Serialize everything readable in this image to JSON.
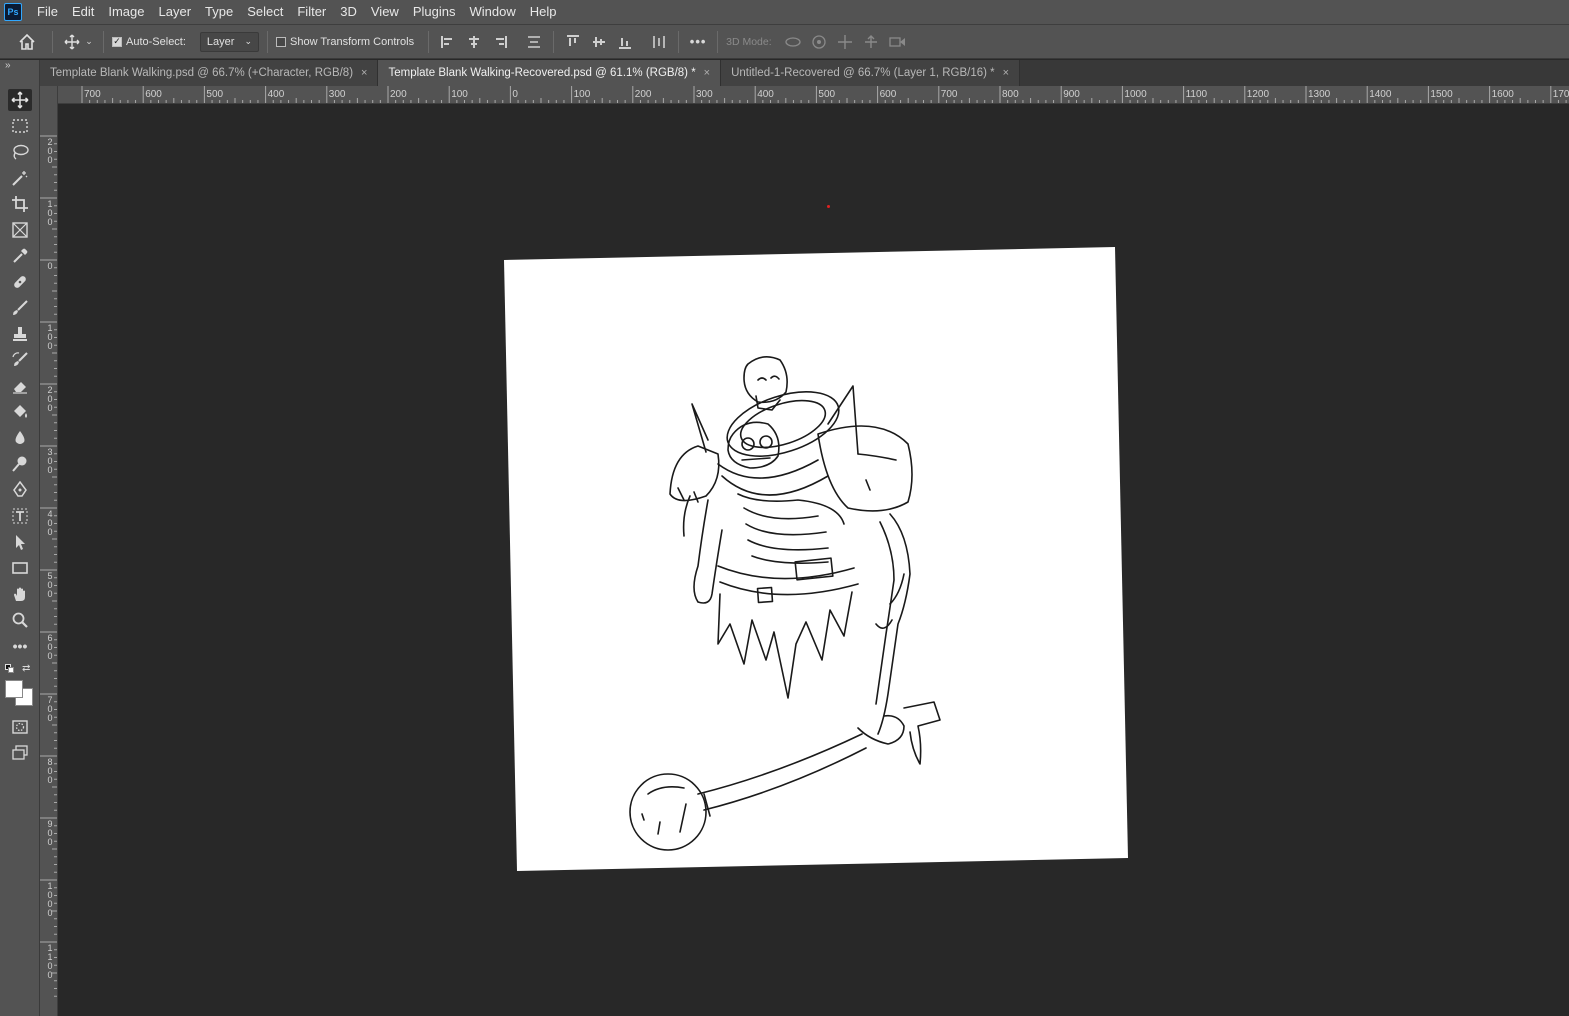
{
  "menubar": {
    "logo": "Ps",
    "items": [
      "File",
      "Edit",
      "Image",
      "Layer",
      "Type",
      "Select",
      "Filter",
      "3D",
      "View",
      "Plugins",
      "Window",
      "Help"
    ]
  },
  "options": {
    "auto_select_label": "Auto-Select:",
    "auto_select_checked": true,
    "auto_select_target": "Layer",
    "show_transform_label": "Show Transform Controls",
    "show_transform_checked": false,
    "more_label": "•••",
    "mode_3d_label": "3D Mode:"
  },
  "tabs": [
    {
      "label": "Template Blank Walking.psd @ 66.7% (+Character, RGB/8)",
      "close": "×",
      "active": false
    },
    {
      "label": "Template Blank Walking-Recovered.psd @ 61.1% (RGB/8) *",
      "close": "×",
      "active": true
    },
    {
      "label": "Untitled-1-Recovered @ 66.7% (Layer 1, RGB/16) *",
      "close": "×",
      "active": false
    }
  ],
  "toolbar": {
    "collapse": "»",
    "more": "•••"
  },
  "ruler": {
    "top_labels": [
      "700",
      "600",
      "500",
      "400",
      "300",
      "200",
      "100",
      "0",
      "100",
      "200",
      "300",
      "400",
      "500",
      "600",
      "700",
      "800",
      "900",
      "1000",
      "1100",
      "1200",
      "1300",
      "1400",
      "1500",
      "1600",
      "1700"
    ],
    "left_labels": [
      "200",
      "100",
      "0",
      "100",
      "200",
      "300",
      "400",
      "500",
      "600",
      "700",
      "800",
      "900",
      "1000",
      "1100"
    ]
  },
  "colors": {
    "ui_panel": "#535353",
    "canvas_bg": "#282828",
    "document": "#ffffff",
    "accent": "#31a8ff"
  }
}
